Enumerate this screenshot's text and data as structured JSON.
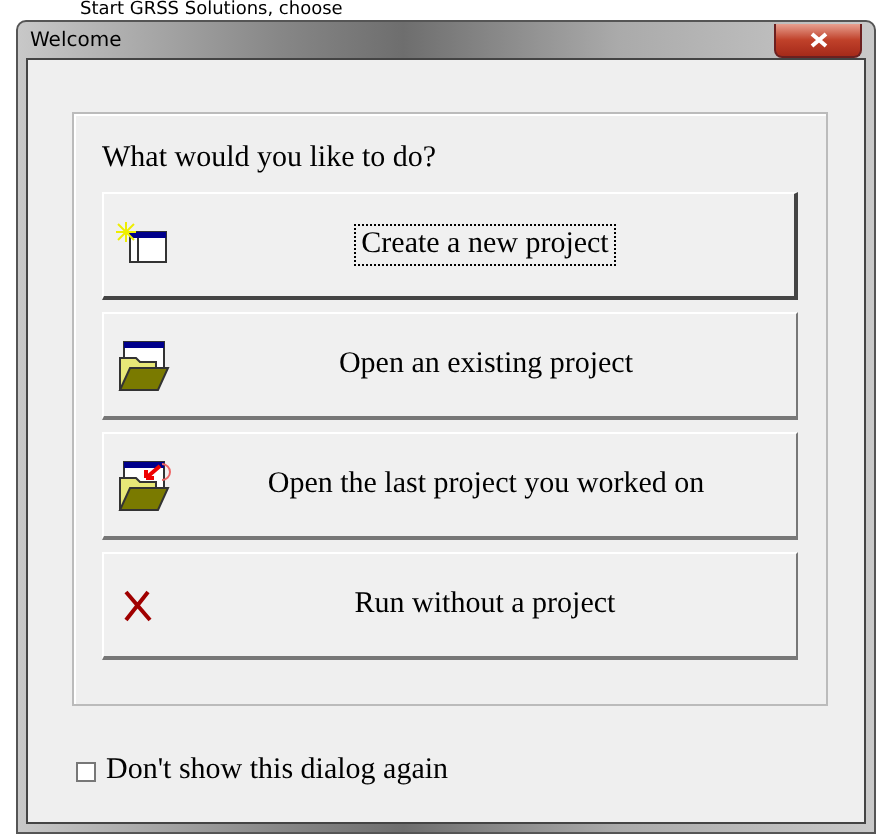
{
  "background_heading": "Start GRSS Solutions, choose",
  "window": {
    "title": "Welcome"
  },
  "prompt": "What would you like to do?",
  "actions": [
    {
      "kind": "new",
      "label": "Create a new project",
      "focused": true
    },
    {
      "kind": "open",
      "label": "Open an existing project",
      "focused": false
    },
    {
      "kind": "last",
      "label": "Open the last project you worked on",
      "focused": false
    },
    {
      "kind": "none",
      "label": "Run without a project",
      "focused": false
    }
  ],
  "dont_show_again": {
    "label": "Don't show this dialog again",
    "checked": false
  }
}
